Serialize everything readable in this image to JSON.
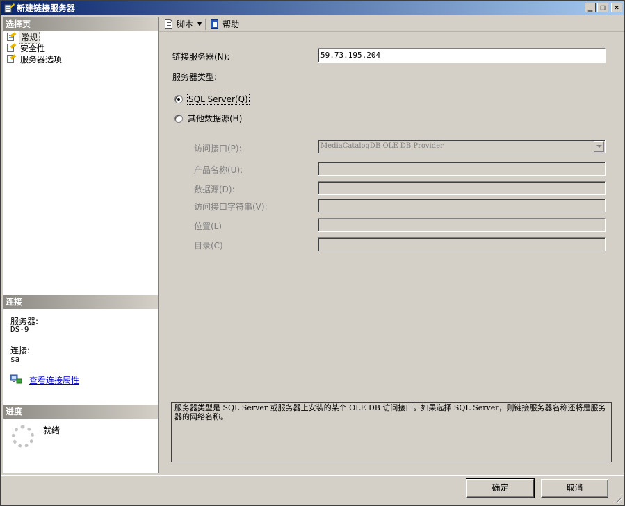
{
  "window": {
    "title": "新建链接服务器",
    "controls": {
      "minimize": "_",
      "maximize": "□",
      "close": "×"
    }
  },
  "left": {
    "select_page_header": "选择页",
    "pages": [
      {
        "label": "常规",
        "icon": "page-wizard-icon",
        "selected": true
      },
      {
        "label": "安全性",
        "icon": "page-wizard-icon",
        "selected": false
      },
      {
        "label": "服务器选项",
        "icon": "page-wizard-icon",
        "selected": false
      }
    ],
    "connection_header": "连接",
    "server_label": "服务器:",
    "server_value": "DS-9",
    "connection_label": "连接:",
    "connection_value": "sa",
    "view_connection_link": "查看连接属性",
    "progress_header": "进度",
    "progress_status": "就绪"
  },
  "toolbar": {
    "script_label": "脚本",
    "help_label": "帮助"
  },
  "form": {
    "linked_server_label": "链接服务器(N):",
    "linked_server_value": "59.73.195.204",
    "server_type_label": "服务器类型:",
    "radio_sql_server": "SQL Server(Q)",
    "radio_other_source": "其他数据源(H)",
    "selected_type": "SQL Server",
    "provider_label": "访问接口(P):",
    "provider_value": "MediaCatalogDB OLE DB Provider",
    "product_name_label": "产品名称(U):",
    "data_source_label": "数据源(D):",
    "provider_string_label": "访问接口字符串(V):",
    "location_label": "位置(L)",
    "catalog_label": "目录(C)",
    "description": "服务器类型是 SQL Server 或服务器上安装的某个 OLE DB 访问接口。如果选择 SQL Server，则链接服务器名称还将是服务器的网络名称。"
  },
  "buttons": {
    "ok": "确定",
    "cancel": "取消"
  }
}
